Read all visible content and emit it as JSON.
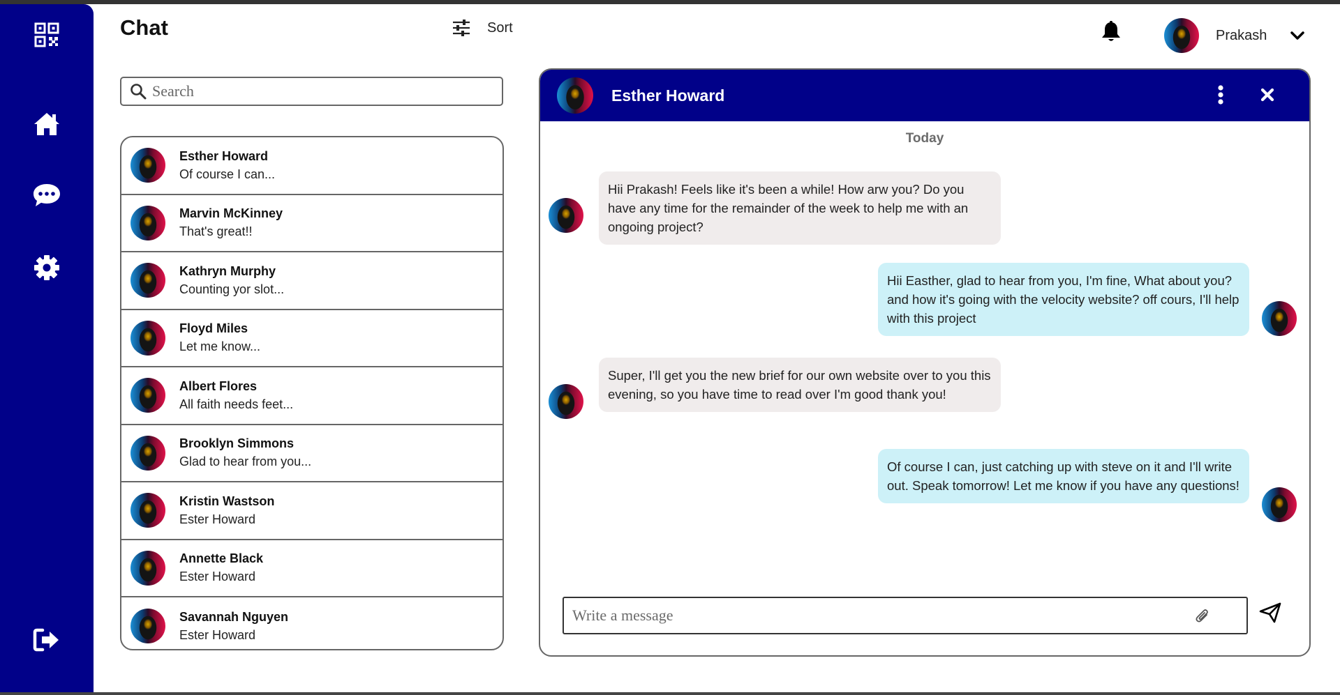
{
  "app": {
    "title": "Chat",
    "brand_color": "#010189",
    "sidebar_icons": [
      "qr-code-icon",
      "home-icon",
      "chat-bubble-icon",
      "settings-gear-icon",
      "logout-icon"
    ]
  },
  "header": {
    "sort_label": "Sort",
    "user_name": "Prakash"
  },
  "search": {
    "placeholder": "Search"
  },
  "contacts": [
    {
      "name": "Esther Howard",
      "preview": "Of course I can..."
    },
    {
      "name": "Marvin McKinney",
      "preview": "That's great!!"
    },
    {
      "name": "Kathryn Murphy",
      "preview": "Counting yor slot..."
    },
    {
      "name": "Floyd Miles",
      "preview": "Let me know..."
    },
    {
      "name": "Albert Flores",
      "preview": "All faith needs feet..."
    },
    {
      "name": "Brooklyn Simmons",
      "preview": "Glad to hear from you..."
    },
    {
      "name": "Kristin Wastson",
      "preview": "Ester Howard"
    },
    {
      "name": "Annette Black",
      "preview": "Ester Howard"
    },
    {
      "name": "Savannah Nguyen",
      "preview": "Ester Howard"
    }
  ],
  "chat": {
    "contact_name": "Esther Howard",
    "day_label": "Today",
    "messages": [
      {
        "direction": "in",
        "text": "Hii Prakash! Feels like it's been a while! How arw you? Do you have any time for the remainder of the week to help me with an ongoing project?"
      },
      {
        "direction": "out",
        "text": "Hii Easther, glad to hear from you, I'm fine, What about you? and how it's going with the velocity website? off cours, I'll help with this project"
      },
      {
        "direction": "in",
        "text": "Super, I'll get you the new brief for our own website over to you this evening, so you have time to read over I'm good thank you!"
      },
      {
        "direction": "out",
        "text": "Of course I can, just catching up with steve on it and I'll write out. Speak tomorrow! Let me know if you have any questions!"
      }
    ],
    "composer_placeholder": "Write a message",
    "incoming_bubble_color": "#f0ecec",
    "outgoing_bubble_color": "#cdf1f8"
  }
}
